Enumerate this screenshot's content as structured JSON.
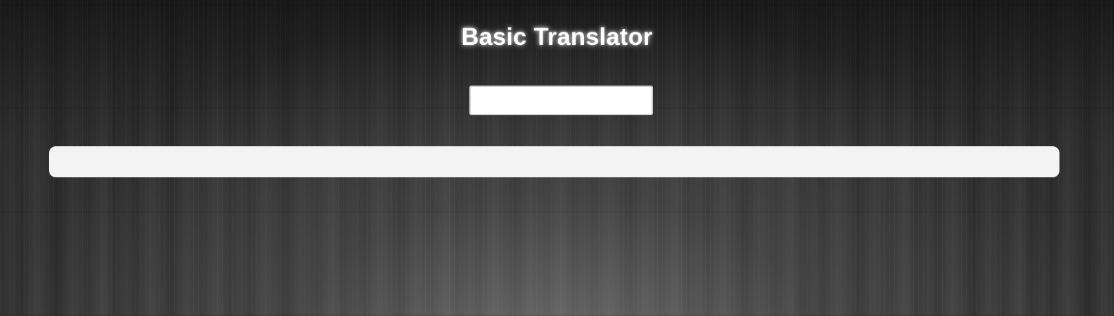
{
  "app": {
    "title": "Basic Translator"
  },
  "input": {
    "value": "",
    "placeholder": ""
  },
  "output": {
    "text": ""
  },
  "colors": {
    "title_text": "#ffffff",
    "input_background": "#ffffff",
    "output_background": "#f3f3f3",
    "page_background": "#3a3a3a"
  }
}
